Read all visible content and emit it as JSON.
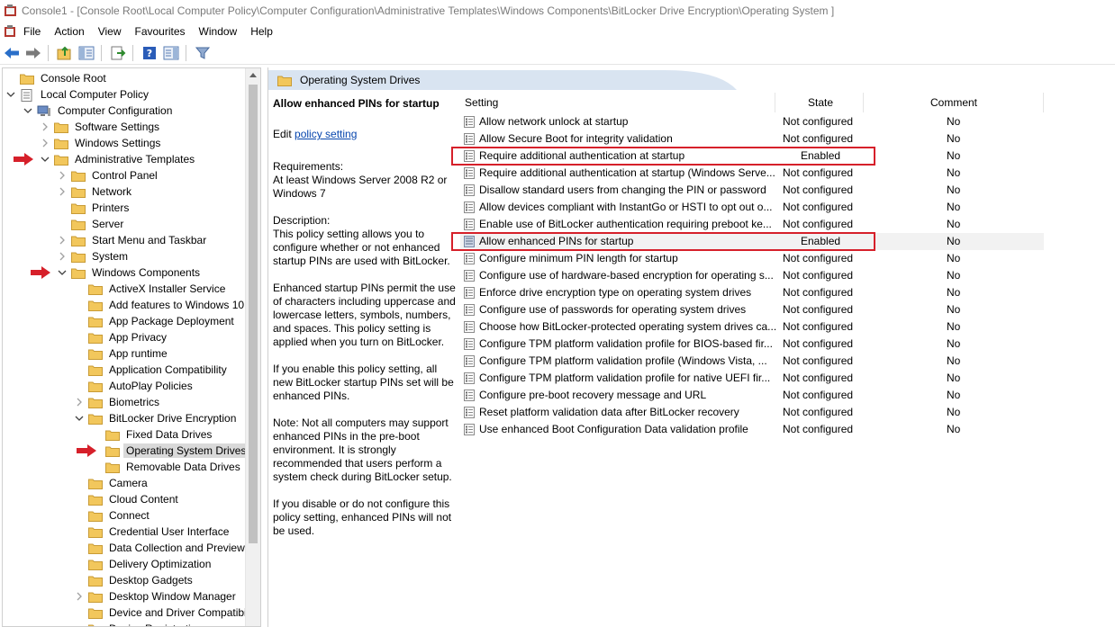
{
  "window": {
    "title": "Console1 - [Console Root\\Local Computer Policy\\Computer Configuration\\Administrative Templates\\Windows Components\\BitLocker Drive Encryption\\Operating System ]"
  },
  "menu": [
    "File",
    "Action",
    "View",
    "Favourites",
    "Window",
    "Help"
  ],
  "toolbar": {
    "icons": [
      "back-arrow-icon",
      "forward-arrow-icon",
      "up-folder-icon",
      "show-hide-tree-icon",
      "export-list-icon",
      "help-icon",
      "properties-pane-icon",
      "filter-icon"
    ]
  },
  "tree": [
    {
      "label": "Console Root",
      "level": 0,
      "chevron": "none"
    },
    {
      "label": "Local Computer Policy",
      "level": 0,
      "chevron": "down"
    },
    {
      "label": "Computer Configuration",
      "level": 1,
      "chevron": "down"
    },
    {
      "label": "Software Settings",
      "level": 2,
      "chevron": "right"
    },
    {
      "label": "Windows Settings",
      "level": 2,
      "chevron": "right"
    },
    {
      "label": "Administrative Templates",
      "level": 2,
      "chevron": "down",
      "marked": true
    },
    {
      "label": "Control Panel",
      "level": 3,
      "chevron": "right"
    },
    {
      "label": "Network",
      "level": 3,
      "chevron": "right"
    },
    {
      "label": "Printers",
      "level": 3,
      "chevron": "none"
    },
    {
      "label": "Server",
      "level": 3,
      "chevron": "none"
    },
    {
      "label": "Start Menu and Taskbar",
      "level": 3,
      "chevron": "right"
    },
    {
      "label": "System",
      "level": 3,
      "chevron": "right"
    },
    {
      "label": "Windows Components",
      "level": 3,
      "chevron": "down",
      "marked": true
    },
    {
      "label": "ActiveX Installer Service",
      "level": 4,
      "chevron": "none"
    },
    {
      "label": "Add features to Windows 10",
      "level": 4,
      "chevron": "none"
    },
    {
      "label": "App Package Deployment",
      "level": 4,
      "chevron": "none"
    },
    {
      "label": "App Privacy",
      "level": 4,
      "chevron": "none"
    },
    {
      "label": "App runtime",
      "level": 4,
      "chevron": "none"
    },
    {
      "label": "Application Compatibility",
      "level": 4,
      "chevron": "none"
    },
    {
      "label": "AutoPlay Policies",
      "level": 4,
      "chevron": "none"
    },
    {
      "label": "Biometrics",
      "level": 4,
      "chevron": "right"
    },
    {
      "label": "BitLocker Drive Encryption",
      "level": 4,
      "chevron": "down"
    },
    {
      "label": "Fixed Data Drives",
      "level": 5,
      "chevron": "none"
    },
    {
      "label": "Operating System Drives",
      "level": 5,
      "chevron": "none",
      "selected": true,
      "marked": true
    },
    {
      "label": "Removable Data Drives",
      "level": 5,
      "chevron": "none"
    },
    {
      "label": "Camera",
      "level": 4,
      "chevron": "none"
    },
    {
      "label": "Cloud Content",
      "level": 4,
      "chevron": "none"
    },
    {
      "label": "Connect",
      "level": 4,
      "chevron": "none"
    },
    {
      "label": "Credential User Interface",
      "level": 4,
      "chevron": "none"
    },
    {
      "label": "Data Collection and Preview",
      "level": 4,
      "chevron": "none"
    },
    {
      "label": "Delivery Optimization",
      "level": 4,
      "chevron": "none"
    },
    {
      "label": "Desktop Gadgets",
      "level": 4,
      "chevron": "none"
    },
    {
      "label": "Desktop Window Manager",
      "level": 4,
      "chevron": "right"
    },
    {
      "label": "Device and Driver Compatibi",
      "level": 4,
      "chevron": "none"
    },
    {
      "label": "Device Registration",
      "level": 4,
      "chevron": "none"
    }
  ],
  "right_pane": {
    "header_title": "Operating System Drives",
    "description": {
      "title": "Allow enhanced PINs for startup",
      "edit_prefix": "Edit ",
      "edit_link": "policy setting ",
      "requirements_label": "Requirements:",
      "requirements_text": "At least Windows Server 2008 R2 or Windows 7",
      "description_label": "Description:",
      "p1": "This policy setting allows you to configure whether or not enhanced startup PINs are used with BitLocker.",
      "p2": "Enhanced startup PINs permit the use of characters including uppercase and lowercase letters, symbols, numbers, and spaces. This policy setting is applied when you turn on BitLocker.",
      "p3": "If you enable this policy setting, all new BitLocker startup PINs set will be enhanced PINs.",
      "p4": "Note:   Not all computers may support enhanced PINs in the pre-boot environment. It is strongly recommended that users perform a system check during BitLocker setup.",
      "p5": "If you disable or do not configure this policy setting, enhanced PINs will not be used."
    },
    "columns": {
      "setting": "Setting",
      "state": "State",
      "comment": "Comment"
    },
    "rows": [
      {
        "setting": "Allow network unlock at startup",
        "state": "Not configured",
        "comment": "No"
      },
      {
        "setting": "Allow Secure Boot for integrity validation",
        "state": "Not configured",
        "comment": "No"
      },
      {
        "setting": "Require additional authentication at startup",
        "state": "Enabled",
        "comment": "No",
        "boxed": true
      },
      {
        "setting": "Require additional authentication at startup (Windows Serve...",
        "state": "Not configured",
        "comment": "No"
      },
      {
        "setting": "Disallow standard users from changing the PIN or password",
        "state": "Not configured",
        "comment": "No"
      },
      {
        "setting": "Allow devices compliant with InstantGo or HSTI to opt out o...",
        "state": "Not configured",
        "comment": "No"
      },
      {
        "setting": "Enable use of BitLocker authentication requiring preboot ke...",
        "state": "Not configured",
        "comment": "No"
      },
      {
        "setting": "Allow enhanced PINs for startup",
        "state": "Enabled",
        "comment": "No",
        "boxed": true,
        "highlight": true
      },
      {
        "setting": "Configure minimum PIN length for startup",
        "state": "Not configured",
        "comment": "No"
      },
      {
        "setting": "Configure use of hardware-based encryption for operating s...",
        "state": "Not configured",
        "comment": "No"
      },
      {
        "setting": "Enforce drive encryption type on operating system drives",
        "state": "Not configured",
        "comment": "No"
      },
      {
        "setting": "Configure use of passwords for operating system drives",
        "state": "Not configured",
        "comment": "No"
      },
      {
        "setting": "Choose how BitLocker-protected operating system drives ca...",
        "state": "Not configured",
        "comment": "No"
      },
      {
        "setting": "Configure TPM platform validation profile for BIOS-based fir...",
        "state": "Not configured",
        "comment": "No"
      },
      {
        "setting": "Configure TPM platform validation profile (Windows Vista, ...",
        "state": "Not configured",
        "comment": "No"
      },
      {
        "setting": "Configure TPM platform validation profile for native UEFI fir...",
        "state": "Not configured",
        "comment": "No"
      },
      {
        "setting": "Configure pre-boot recovery message and URL",
        "state": "Not configured",
        "comment": "No"
      },
      {
        "setting": "Reset platform validation data after BitLocker recovery",
        "state": "Not configured",
        "comment": "No"
      },
      {
        "setting": "Use enhanced Boot Configuration Data validation profile",
        "state": "Not configured",
        "comment": "No"
      }
    ]
  },
  "colors": {
    "annotation_red": "#d6202a",
    "folder_yellow": "#f2c75c",
    "selection_gray": "#d9d9d9",
    "header_blue": "#d9e4f1",
    "link_blue": "#0645ad"
  }
}
